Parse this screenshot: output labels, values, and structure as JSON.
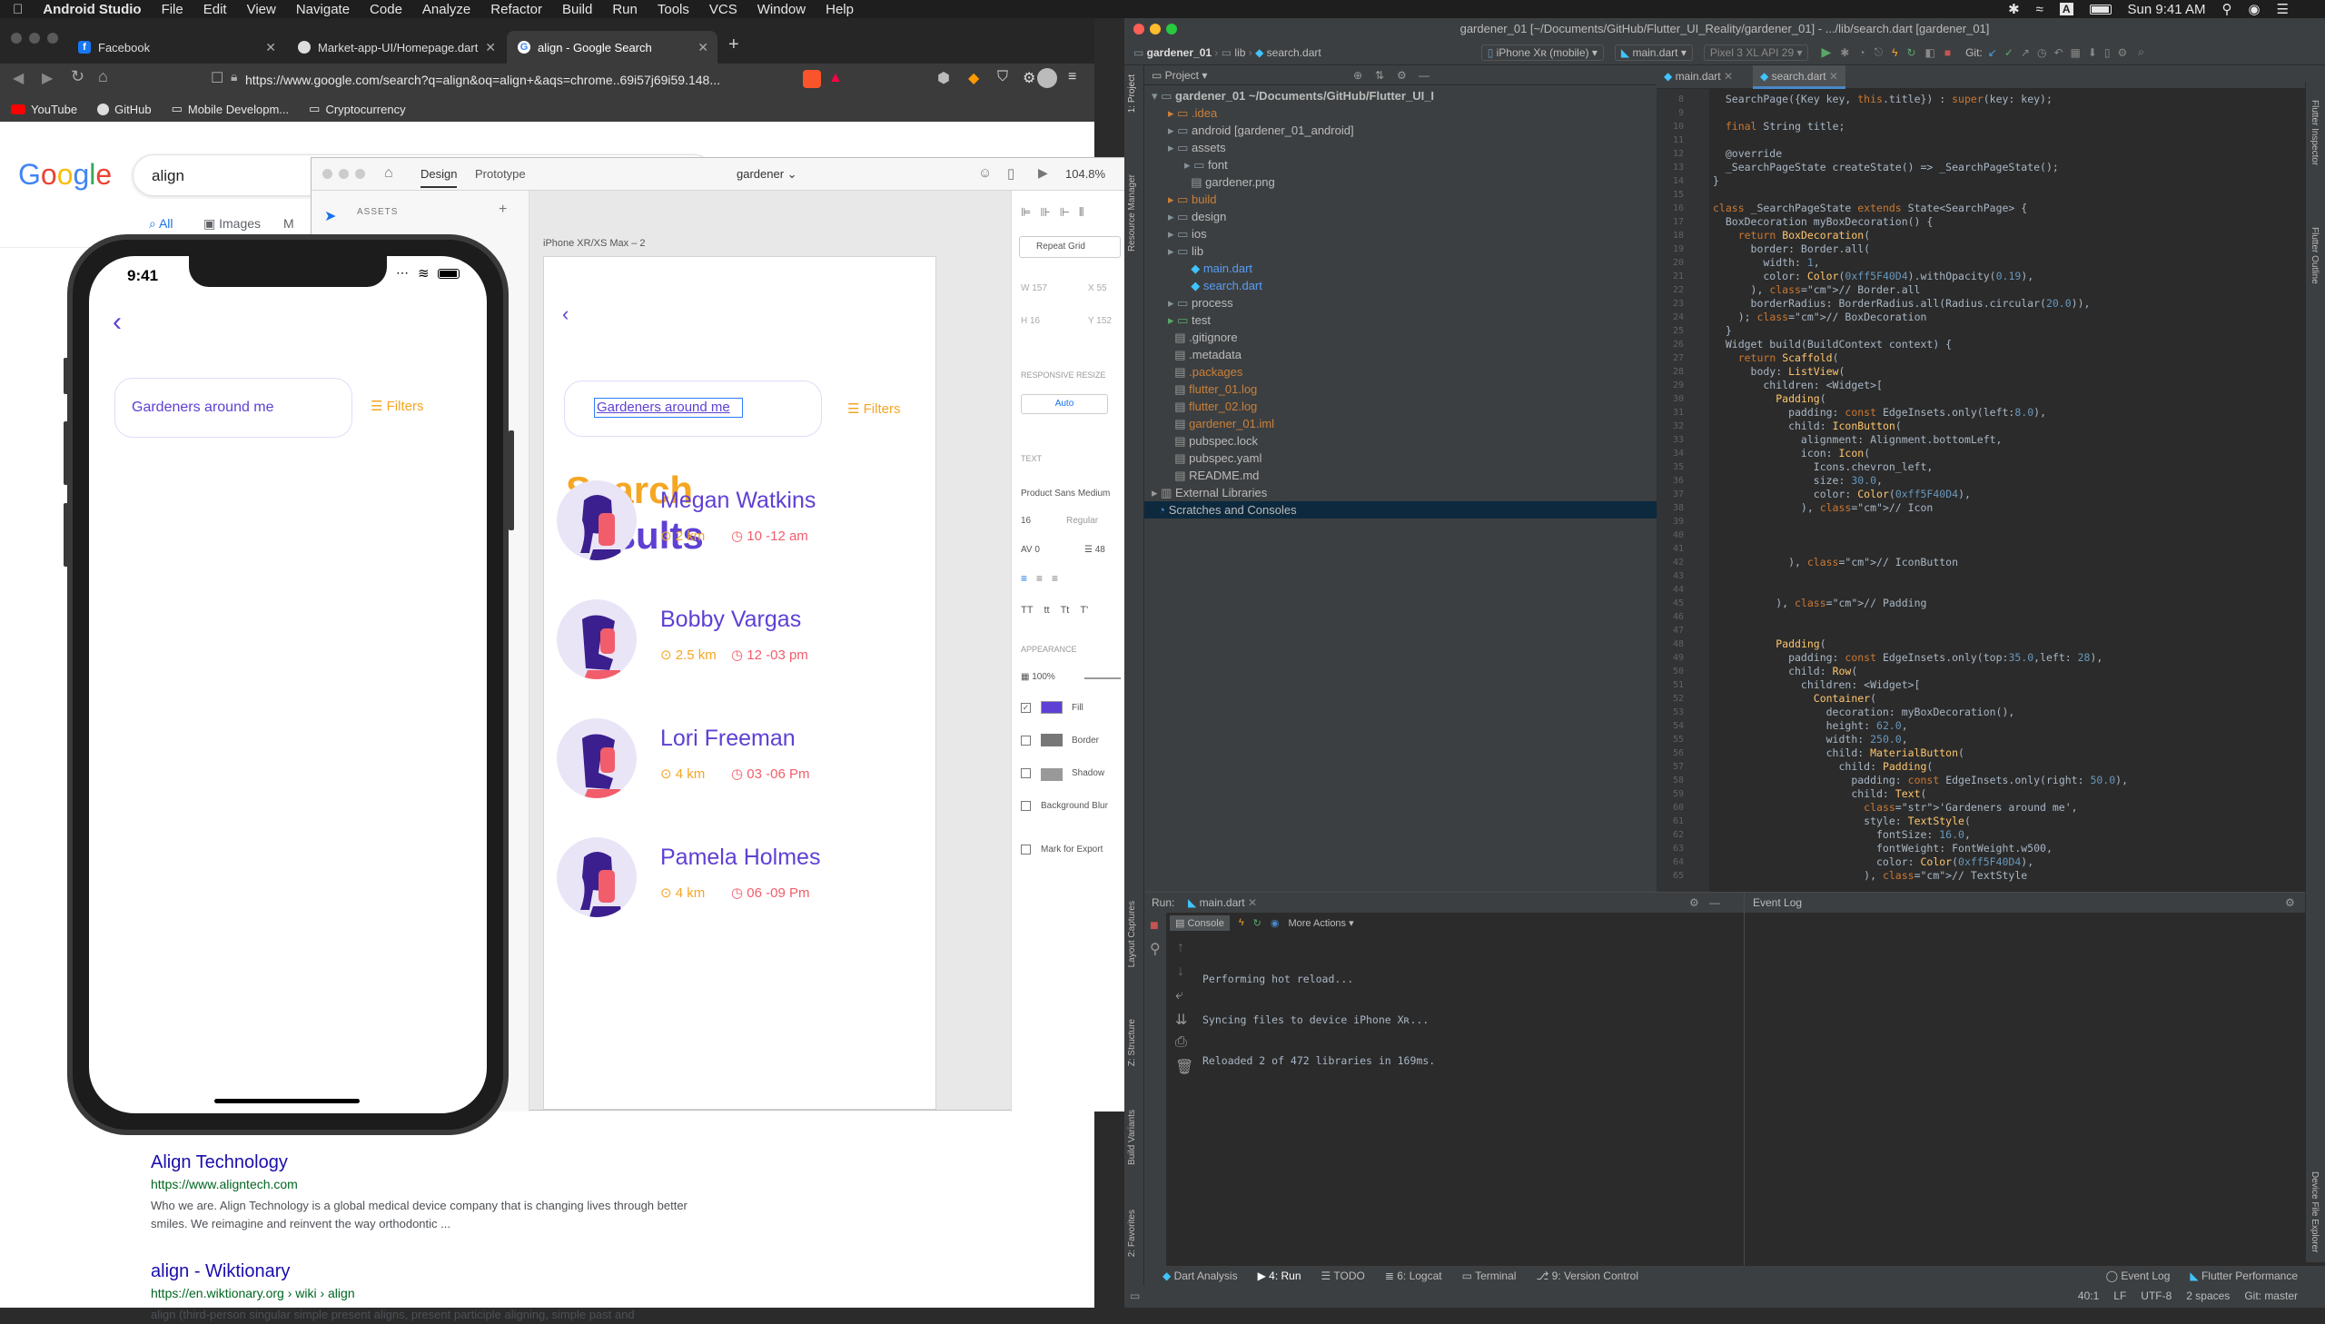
{
  "menubar": {
    "app": "Android Studio",
    "items": [
      "File",
      "Edit",
      "View",
      "Navigate",
      "Code",
      "Analyze",
      "Refactor",
      "Build",
      "Run",
      "Tools",
      "VCS",
      "Window",
      "Help"
    ],
    "clock": "Sun 9:41 AM"
  },
  "browser": {
    "tabs": [
      {
        "label": "Facebook"
      },
      {
        "label": "Market-app-UI/Homepage.dart"
      },
      {
        "label": "align - Google Search"
      }
    ],
    "url": "https://www.google.com/search?q=align&oq=align+&aqs=chrome..69i57j69i59.148...",
    "bookmarks": [
      "YouTube",
      "GitHub",
      "Mobile Developm...",
      "Cryptocurrency"
    ],
    "google": {
      "logo": "Google",
      "query": "align",
      "tabs": [
        "All",
        "Images",
        "M"
      ],
      "results": [
        {
          "title": "Align Technology",
          "url": "https://www.aligntech.com",
          "desc": "Who we are. Align Technology is a global medical device company that is changing lives through better smiles. We reimagine and reinvent the way orthodontic ..."
        },
        {
          "title": "align - Wiktionary",
          "url": "https://en.wiktionary.org › wiki › align",
          "desc": "align (third-person singular simple present aligns, present participle aligning, simple past and"
        }
      ]
    }
  },
  "phone": {
    "time": "9:41",
    "search_text": "Gardeners around me",
    "filters": "Filters"
  },
  "figma": {
    "tabs": [
      "Design",
      "Prototype"
    ],
    "file": "gardener",
    "zoom": "104.8%",
    "assets": "ASSETS",
    "artboard_label": "iPhone XR/XS Max – 2",
    "search_text": "Gardeners around me",
    "filters": "Filters",
    "heading_1": "Search",
    "heading_2": "Results",
    "people": [
      {
        "name": "Megan Watkins",
        "distance": "2 km",
        "hours": "10 -12 am",
        "avatar": "female"
      },
      {
        "name": "Bobby Vargas",
        "distance": "2.5 km",
        "hours": "12 -03 pm",
        "avatar": "male"
      },
      {
        "name": "Lori Freeman",
        "distance": "4 km",
        "hours": "03 -06 Pm",
        "avatar": "male"
      },
      {
        "name": "Pamela Holmes",
        "distance": "4 km",
        "hours": "06 -09 Pm",
        "avatar": "female"
      }
    ],
    "inspector": {
      "repeat_grid": "Repeat Grid",
      "w": "157",
      "x": "55",
      "h": "16",
      "y": "152",
      "responsive": "RESPONSIVE RESIZE",
      "auto": "Auto",
      "text": "TEXT",
      "font": "Product Sans Medium",
      "size": "16",
      "weight": "Regular",
      "tracking": "0",
      "line": "48",
      "appearance": "APPEARANCE",
      "opacity": "100%",
      "fill": "Fill",
      "border": "Border",
      "shadow": "Shadow",
      "blur": "Background Blur",
      "export": "Mark for Export"
    },
    "colors": {
      "orange": "#f5a623",
      "purple": "#5f40d4",
      "fill": "#5f40d4"
    }
  },
  "studio": {
    "title": "gardener_01 [~/Documents/GitHub/Flutter_UI_Reality/gardener_01] - .../lib/search.dart [gardener_01]",
    "breadcrumb": [
      "gardener_01",
      "lib",
      "search.dart"
    ],
    "device": "iPhone Xʀ (mobile)",
    "run_config": "main.dart",
    "emulator": "Pixel 3 XL API 29",
    "git": "Git:",
    "project_label": "Project",
    "editor_tabs": [
      "main.dart",
      "search.dart"
    ],
    "tree": [
      {
        "label": "gardener_01  ~/Documents/GitHub/Flutter_UI_I",
        "depth": 0,
        "kind": "root"
      },
      {
        "label": ".idea",
        "depth": 1,
        "kind": "folder-orange"
      },
      {
        "label": "android [gardener_01_android]",
        "depth": 1,
        "kind": "folder"
      },
      {
        "label": "assets",
        "depth": 1,
        "kind": "folder"
      },
      {
        "label": "font",
        "depth": 2,
        "kind": "folder"
      },
      {
        "label": "gardener.png",
        "depth": 2,
        "kind": "file"
      },
      {
        "label": "build",
        "depth": 1,
        "kind": "folder-orange"
      },
      {
        "label": "design",
        "depth": 1,
        "kind": "folder"
      },
      {
        "label": "ios",
        "depth": 1,
        "kind": "folder"
      },
      {
        "label": "lib",
        "depth": 1,
        "kind": "folder"
      },
      {
        "label": "main.dart",
        "depth": 2,
        "kind": "dart"
      },
      {
        "label": "search.dart",
        "depth": 2,
        "kind": "dart"
      },
      {
        "label": "process",
        "depth": 1,
        "kind": "folder"
      },
      {
        "label": "test",
        "depth": 1,
        "kind": "folder-green"
      },
      {
        "label": ".gitignore",
        "depth": 1,
        "kind": "file"
      },
      {
        "label": ".metadata",
        "depth": 1,
        "kind": "file"
      },
      {
        "label": ".packages",
        "depth": 1,
        "kind": "file-orange"
      },
      {
        "label": "flutter_01.log",
        "depth": 1,
        "kind": "file-orange"
      },
      {
        "label": "flutter_02.log",
        "depth": 1,
        "kind": "file-orange"
      },
      {
        "label": "gardener_01.iml",
        "depth": 1,
        "kind": "file-orange"
      },
      {
        "label": "pubspec.lock",
        "depth": 1,
        "kind": "file"
      },
      {
        "label": "pubspec.yaml",
        "depth": 1,
        "kind": "file"
      },
      {
        "label": "README.md",
        "depth": 1,
        "kind": "file"
      },
      {
        "label": "External Libraries",
        "depth": 0,
        "kind": "lib"
      },
      {
        "label": "Scratches and Consoles",
        "depth": 0,
        "kind": "scratch"
      }
    ],
    "code_start": 8,
    "code": [
      "  SearchPage({Key key, this.title}) : super(key: key);",
      "",
      "  final String title;",
      "",
      "  @override",
      "  _SearchPageState createState() => _SearchPageState();",
      "}",
      "",
      "class _SearchPageState extends State<SearchPage> {",
      "  BoxDecoration myBoxDecoration() {",
      "    return BoxDecoration(",
      "      border: Border.all(",
      "        width: 1,",
      "        color: Color(0xff5F40D4).withOpacity(0.19),",
      "      ), // Border.all",
      "      borderRadius: BorderRadius.all(Radius.circular(20.0)),",
      "    ); // BoxDecoration",
      "  }",
      "  Widget build(BuildContext context) {",
      "    return Scaffold(",
      "      body: ListView(",
      "        children: <Widget>[",
      "          Padding(",
      "            padding: const EdgeInsets.only(left:8.0),",
      "            child: IconButton(",
      "              alignment: Alignment.bottomLeft,",
      "              icon: Icon(",
      "                Icons.chevron_left,",
      "                size: 30.0,",
      "                color: Color(0xff5F40D4),",
      "              ), // Icon",
      "",
      "",
      "",
      "            ), // IconButton",
      "",
      "",
      "          ), // Padding",
      "",
      "",
      "          Padding(",
      "            padding: const EdgeInsets.only(top:35.0,left: 28),",
      "            child: Row(",
      "              children: <Widget>[",
      "                Container(",
      "                  decoration: myBoxDecoration(),",
      "                  height: 62.0,",
      "                  width: 250.0,",
      "                  child: MaterialButton(",
      "                    child: Padding(",
      "                      padding: const EdgeInsets.only(right: 50.0),",
      "                      child: Text(",
      "                        'Gardeners around me',",
      "                        style: TextStyle(",
      "                          fontSize: 16.0,",
      "                          fontWeight: FontWeight.w500,",
      "                          color: Color(0xff5F40D4),",
      "                        ), // TextStyle"
    ],
    "run_label": "Run:",
    "run_tab": "main.dart",
    "console_label": "Console",
    "more_actions": "More Actions",
    "console": [
      "Performing hot reload...",
      "Syncing files to device iPhone Xʀ...",
      "Reloaded 2 of 472 libraries in 169ms."
    ],
    "event_log": "Event Log",
    "bottom_tabs": [
      "Dart Analysis",
      "4: Run",
      "TODO",
      "6: Logcat",
      "Terminal",
      "9: Version Control"
    ],
    "status_right": [
      "Event Log",
      "Flutter Performance"
    ],
    "status": [
      "40:1",
      "LF",
      "UTF-8",
      "2 spaces",
      "Git: master"
    ],
    "side_labels": [
      "1: Project",
      "Resource Manager",
      "Layout Captures",
      "Z: Structure",
      "Build Variants",
      "2: Favorites"
    ],
    "right_labels": [
      "Flutter Inspector",
      "Flutter Outline",
      "Device File Explorer"
    ]
  }
}
